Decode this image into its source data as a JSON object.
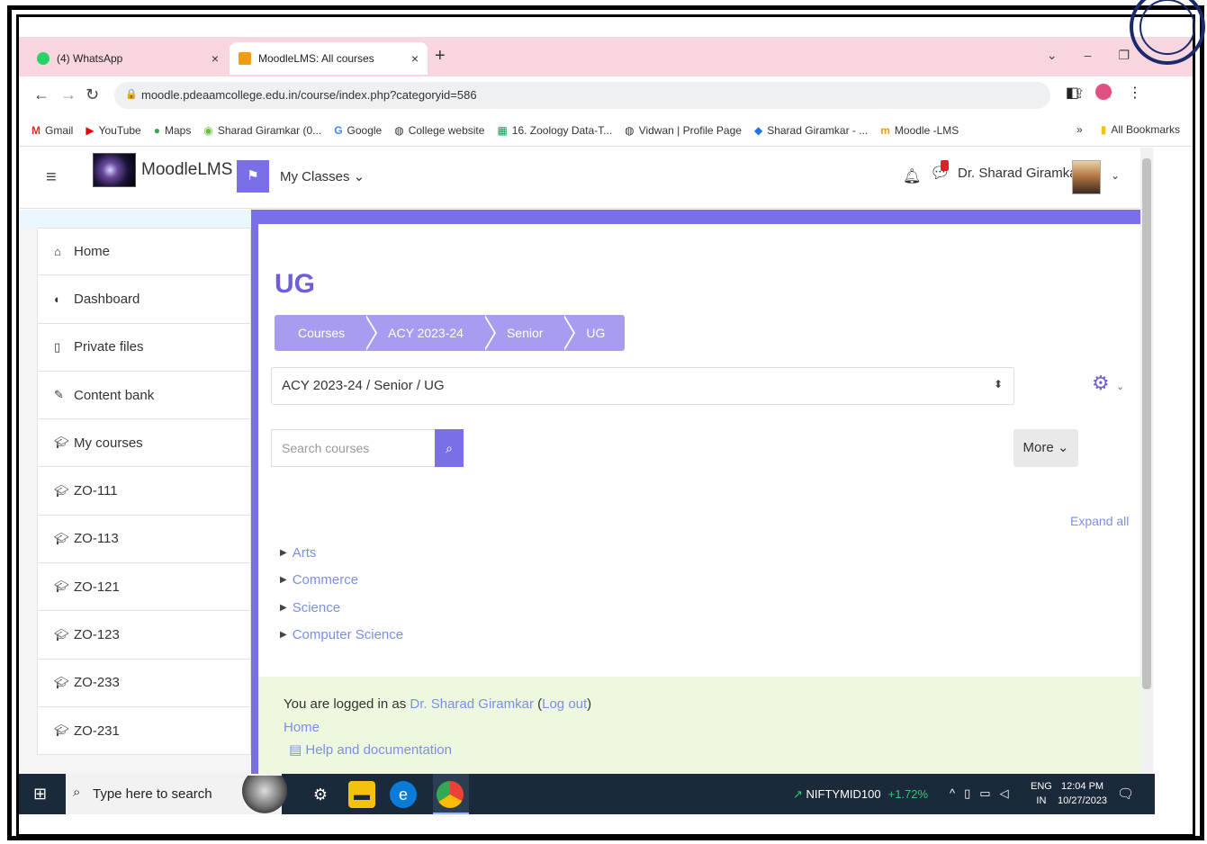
{
  "browser": {
    "tabs": [
      {
        "label": "(4) WhatsApp",
        "close": "×"
      },
      {
        "label": "MoodleLMS: All courses",
        "close": "×"
      }
    ],
    "new_tab": "+",
    "url": "moodle.pdeaamcollege.edu.in/course/index.php?categoryid=586",
    "bookmarks": [
      "Gmail",
      "YouTube",
      "Maps",
      "Sharad Giramkar (0...",
      "Google",
      "College website",
      "16. Zoology Data-T...",
      "Vidwan | Profile Page",
      "Sharad Giramkar - ...",
      "Moodle -LMS"
    ],
    "bookmarks_more": "»",
    "all_bookmarks": "All Bookmarks"
  },
  "moodle": {
    "site_name": "MoodleLMS",
    "my_classes": "My Classes",
    "user_name": "Dr. Sharad Giramkar"
  },
  "sidebar": {
    "items": [
      {
        "label": "Home",
        "icon": "home-icon"
      },
      {
        "label": "Dashboard",
        "icon": "dashboard-icon"
      },
      {
        "label": "Private files",
        "icon": "file-icon"
      },
      {
        "label": "Content bank",
        "icon": "brush-icon"
      },
      {
        "label": "My courses",
        "icon": "graduation-cap-icon"
      },
      {
        "label": "ZO-111",
        "icon": "graduation-cap-icon"
      },
      {
        "label": "ZO-113",
        "icon": "graduation-cap-icon"
      },
      {
        "label": "ZO-121",
        "icon": "graduation-cap-icon"
      },
      {
        "label": "ZO-123",
        "icon": "graduation-cap-icon"
      },
      {
        "label": "ZO-233",
        "icon": "graduation-cap-icon"
      },
      {
        "label": "ZO-231",
        "icon": "graduation-cap-icon"
      }
    ]
  },
  "main": {
    "title": "UG",
    "breadcrumb": [
      "Courses",
      "ACY 2023-24",
      "Senior",
      "UG"
    ],
    "category_select": "ACY 2023-24 / Senior / UG",
    "search_placeholder": "Search courses",
    "more_label": "More",
    "expand_all": "Expand all",
    "categories": [
      "Arts",
      "Commerce",
      "Science",
      "Computer Science"
    ]
  },
  "footer": {
    "logged_in_prefix": "You are logged in as",
    "user_link": "Dr. Sharad Giramkar",
    "logout_link": "Log out",
    "home_link": "Home",
    "help_link": "Help and documentation"
  },
  "taskbar": {
    "search_placeholder": "Type here to search",
    "stock_name": "NIFTYMID100",
    "stock_change": "+1.72%",
    "lang_line1": "ENG",
    "lang_line2": "IN",
    "time": "12:04 PM",
    "date": "10/27/2023"
  },
  "colors": {
    "accent": "#7b6fe8",
    "link": "#7b8fe8",
    "footer_bg": "#eef8de",
    "tabbar_bg": "#f7d6e0"
  }
}
